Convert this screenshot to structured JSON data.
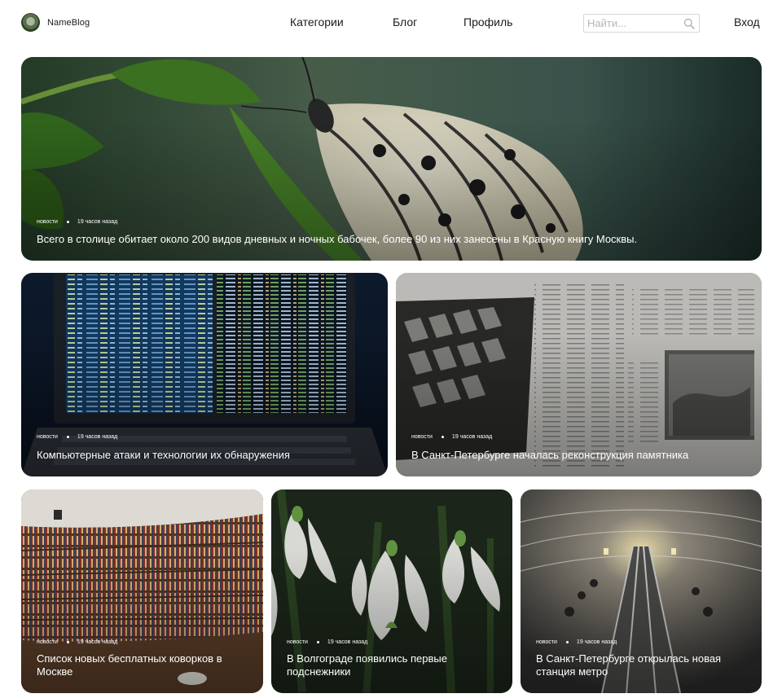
{
  "header": {
    "brand": "NameBlog",
    "nav": [
      "Категории",
      "Блог",
      "Профиль"
    ],
    "search_placeholder": "Найти...",
    "login": "Вход"
  },
  "cards": [
    {
      "tag": "новости",
      "time": "19 часов назад",
      "title": "Всего в столице обитает около 200 видов дневных и ночных бабочек, более 90 из них занесены в Красную книгу Москвы."
    },
    {
      "tag": "новости",
      "time": "19 часов назад",
      "title": "Компьютерные атаки и технологии их обнаружения"
    },
    {
      "tag": "новости",
      "time": "19 часов назад",
      "title": "В Санкт-Петербурге началась реконструкция памятника"
    },
    {
      "tag": "новости",
      "time": "19 часов назад",
      "title": "Список новых бесплатных коворков в Москве"
    },
    {
      "tag": "новости",
      "time": "19 часов назад",
      "title": "В Волгограде появились первые подснежники"
    },
    {
      "tag": "новости",
      "time": "19 часов назад",
      "title": "В Санкт-Петербурге открылась новая станция метро"
    }
  ]
}
